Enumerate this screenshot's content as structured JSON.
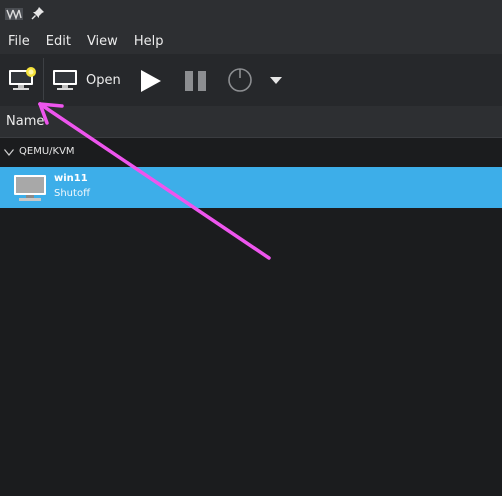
{
  "menubar": {
    "items": [
      "File",
      "Edit",
      "View",
      "Help"
    ]
  },
  "toolbar": {
    "open_label": "Open",
    "icons": [
      "new-vm-icon",
      "monitor-icon",
      "play-icon",
      "pause-icon",
      "power-icon",
      "dropdown-arrow-icon"
    ]
  },
  "list": {
    "column_header": "Name",
    "group": "QEMU/KVM",
    "vms": [
      {
        "name": "win11",
        "status": "Shutoff"
      }
    ]
  },
  "colors": {
    "selection": "#3daee9",
    "annotation_arrow": "#ee55ee",
    "background": "#1b1c1e",
    "toolbar": "#26282b"
  }
}
